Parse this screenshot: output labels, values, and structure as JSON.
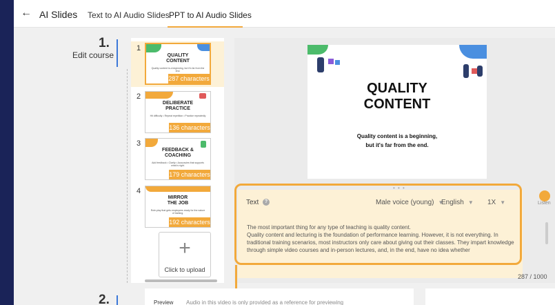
{
  "header": {
    "back_icon": "arrow-left-icon",
    "app_title": "AI Slides",
    "tabs": [
      {
        "label": "Text to AI Audio Slides",
        "active": false
      },
      {
        "label": "PPT to AI Audio Slides",
        "active": true
      }
    ]
  },
  "steps": [
    {
      "number": "1.",
      "label": "Edit course"
    },
    {
      "number": "2.",
      "label": ""
    }
  ],
  "slides": [
    {
      "index": "1",
      "title": "QUALITY\nCONTENT",
      "subtitle": "Quality content is a beginning, but it's far from the end.",
      "chars": "287 characters",
      "selected": true
    },
    {
      "index": "2",
      "title": "DELIBERATE\nPRACTICE",
      "subtitle": "Hit difficulty • Repeat repetition • Practice repeatedly",
      "chars": "136 characters",
      "selected": false
    },
    {
      "index": "3",
      "title": "FEEDBACK &\nCOACHING",
      "subtitle": "Add feedback • Clarity • Accuracies that supports what is right.",
      "chars": "179 characters",
      "selected": false
    },
    {
      "index": "4",
      "title": "MIRROR\nTHE JOB",
      "subtitle": "Role-play that gets employees ready for the nature of training.",
      "chars": "192 characters",
      "selected": false
    }
  ],
  "upload": {
    "label": "Click to upload",
    "icon": "plus-icon"
  },
  "preview_slide": {
    "title": "QUALITY\nCONTENT",
    "subtitle": "Quality content is a beginning,\nbut it's far from the end."
  },
  "text_panel": {
    "label": "Text",
    "help_icon": "question-icon",
    "voice": "Male voice (young)",
    "language": "English",
    "speed": "1X",
    "listen_label": "Listen",
    "body": "The most important thing for any type of teaching is quality content.\nQuality content and lecturing is the foundation of performance learning. However, it is not everything. In traditional training scenarios, most instructors only care about giving out their classes. They impart knowledge through simple video courses and in-person lectures, and, in the end, have no idea whether",
    "counter": "287 / 1000"
  },
  "preview_section": {
    "label": "Preview",
    "note": "Audio in this video is only provided as a reference for previewing"
  },
  "colors": {
    "accent": "#f2a93b",
    "step_bar": "#3a77d8",
    "background": "#1a2358"
  }
}
